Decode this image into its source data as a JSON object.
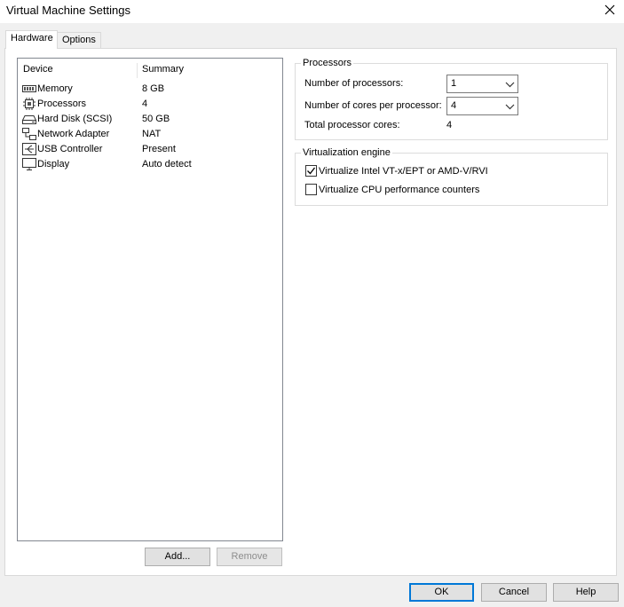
{
  "window": {
    "title": "Virtual Machine Settings"
  },
  "tabs": [
    {
      "label": "Hardware",
      "active": true
    },
    {
      "label": "Options",
      "active": false
    }
  ],
  "device_list": {
    "columns": [
      "Device",
      "Summary"
    ],
    "rows": [
      {
        "device": "Memory",
        "summary": "8 GB",
        "icon": "memory-icon"
      },
      {
        "device": "Processors",
        "summary": "4",
        "icon": "processor-icon"
      },
      {
        "device": "Hard Disk (SCSI)",
        "summary": "50 GB",
        "icon": "hard-disk-icon"
      },
      {
        "device": "Network Adapter",
        "summary": "NAT",
        "icon": "network-adapter-icon"
      },
      {
        "device": "USB Controller",
        "summary": "Present",
        "icon": "usb-icon"
      },
      {
        "device": "Display",
        "summary": "Auto detect",
        "icon": "display-icon"
      }
    ]
  },
  "list_buttons": {
    "add": "Add...",
    "remove": "Remove"
  },
  "processors": {
    "group_title": "Processors",
    "num_processors_label": "Number of processors:",
    "num_processors_value": "1",
    "cores_label": "Number of cores per processor:",
    "cores_value": "4",
    "total_label": "Total processor cores:",
    "total_value": "4"
  },
  "virtualization": {
    "group_title": "Virtualization engine",
    "vtx_label": "Virtualize Intel VT-x/EPT or AMD-V/RVI",
    "vtx_checked": true,
    "perf_label": "Virtualize CPU performance counters",
    "perf_checked": false
  },
  "footer": {
    "ok": "OK",
    "cancel": "Cancel",
    "help": "Help"
  },
  "colors": {
    "accent": "#0078d7",
    "background": "#f0f0f0"
  }
}
